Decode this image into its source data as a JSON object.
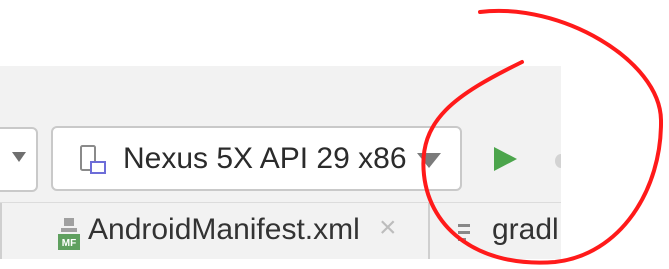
{
  "toolbar": {
    "device_selector": {
      "label": "Nexus 5X API 29 x86",
      "icon": "device-phone-icon"
    },
    "run_icon": "run-icon",
    "accent_color": "#4ca54c"
  },
  "tabs": [
    {
      "label": "AndroidManifest.xml",
      "icon": "manifest-file-icon",
      "icon_text": "MF",
      "close": "×"
    },
    {
      "label": "gradl",
      "icon": "gradle-file-icon"
    }
  ],
  "annotation_color": "#ff1a1a"
}
